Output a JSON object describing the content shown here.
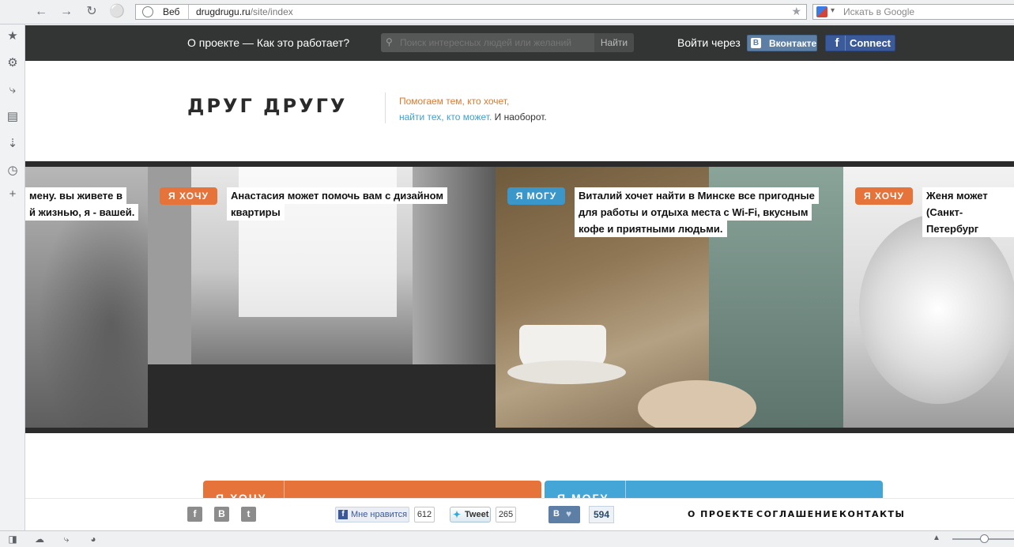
{
  "browser": {
    "address_scheme_label": "Веб",
    "url_host": "drugdrugu.ru",
    "url_path": "/site/index",
    "search_placeholder": "Искать в Google"
  },
  "site_nav": {
    "about_link": "О проекте — Как это работает?",
    "search_placeholder": "Поиск интересных людей или желаний",
    "search_button": "Найти",
    "login_label": "Войти через",
    "vk_button": "Вконтакте",
    "vk_logo": "В",
    "fb_button": "Connect",
    "fb_logo": "f"
  },
  "header": {
    "logo": "ДРУГ ДРУГУ",
    "tagline_line1": "Помогаем тем, кто хочет,",
    "tagline_line2_link": "найти тех, кто может.",
    "tagline_line2_rest": " И наоборот."
  },
  "carousel": {
    "panel1": {
      "caption_line1": "мену. вы живете в",
      "caption_line2": "й жизнью, я - вашей."
    },
    "panel2": {
      "tag": "Я ХОЧУ",
      "caption_line1": "Анастасия может помочь вам с дизайном",
      "caption_line2": "квартиры"
    },
    "panel3": {
      "tag": "Я МОГУ",
      "caption_line1": "Виталий хочет найти в Минске все пригодные",
      "caption_line2": "для работы и отдыха места с Wi-Fi, вкусным",
      "caption_line3": "кофе и приятными людьми."
    },
    "panel4": {
      "tag": "Я ХОЧУ",
      "caption_line1": "Женя может пом",
      "caption_line2": "(Санкт-Петербург"
    }
  },
  "actions": {
    "want_label": "Я ХОЧУ",
    "can_label": "Я МОГУ"
  },
  "footer": {
    "social_fb": "f",
    "social_vk": "B",
    "social_tw": "t",
    "fb_like_label": "Мне нравится",
    "fb_like_count": "612",
    "tweet_label": "Tweet",
    "tweet_count": "265",
    "vk_like_logo": "B",
    "vk_like_count": "594",
    "link_about": "О ПРОЕКТЕ",
    "link_agreement": "СОГЛАШЕНИЕ",
    "link_contacts": "КОНТАКТЫ"
  },
  "colors": {
    "accent_want": "#e5733a",
    "accent_can": "#3b96c9",
    "topbar": "#333434",
    "vk": "#5d7fa5",
    "facebook": "#3b5a9a"
  }
}
